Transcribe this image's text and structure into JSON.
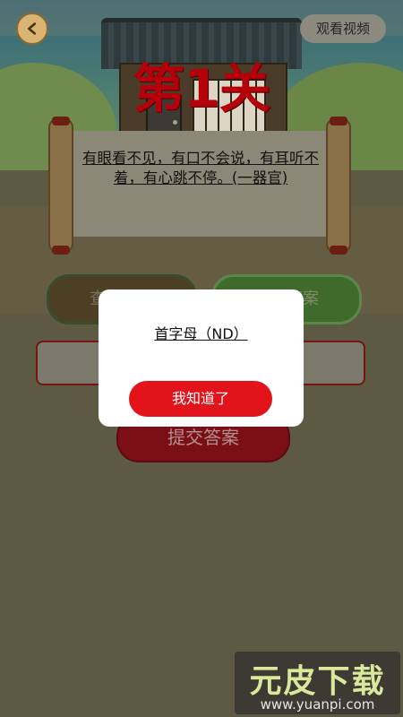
{
  "header": {
    "back_icon": "back-arrow-icon",
    "video_button": "观看视频"
  },
  "level": {
    "title": "第1关"
  },
  "riddle": {
    "text": "有眼看不见，有口不会说，有耳听不着，有心跳不停。(一器官)"
  },
  "actions": {
    "hint_button": "查看提示",
    "answer_button": "查看答案",
    "answer_input_value": "",
    "submit_button": "提交答案"
  },
  "modal": {
    "message": "首字母（ND）",
    "confirm_button": "我知道了"
  },
  "watermark": {
    "brand": "元皮下载",
    "url": "www.yuanpi.com"
  },
  "colors": {
    "modal_button": "#e3131c",
    "level_title": "#b3000a",
    "watermark_text": "#d9e89a"
  }
}
